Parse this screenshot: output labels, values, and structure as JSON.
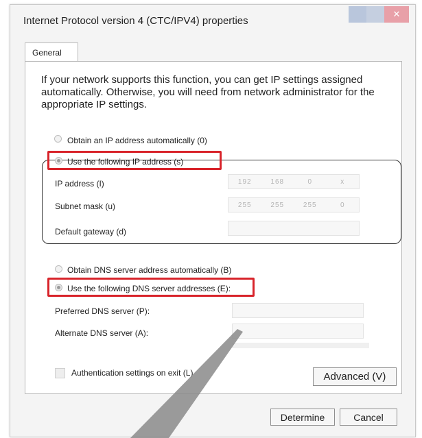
{
  "window": {
    "title": "Internet Protocol version 4 (CTC/IPV4) properties",
    "close_glyph": "✕"
  },
  "tabs": [
    {
      "label": "General"
    }
  ],
  "intro_text": "If your network supports this function, you can get IP settings assigned automatically. Otherwise, you will need from network administrator for the appropriate IP settings.",
  "ip_section": {
    "auto_label": "Obtain an IP address automatically (0)",
    "manual_label": "Use the following IP address (s)",
    "selected": "manual",
    "fields": [
      {
        "label": "IP address (I)",
        "value": [
          "192",
          "168",
          "0",
          "x"
        ]
      },
      {
        "label": "Subnet mask (u)",
        "value": [
          "255",
          "255",
          "255",
          "0"
        ]
      },
      {
        "label": "Default gateway (d)",
        "value": [
          "",
          "",
          "",
          ""
        ]
      }
    ]
  },
  "dns_section": {
    "auto_label": "Obtain DNS server address automatically (B)",
    "manual_label": "Use the following DNS server addresses (E):",
    "selected": "manual",
    "fields": [
      {
        "label": "Preferred DNS server (P):"
      },
      {
        "label": "Alternate DNS server (A):"
      }
    ]
  },
  "auth_label": "Authentication settings on exit (L)",
  "buttons": {
    "advanced": "Advanced (V)",
    "ok": "Determine",
    "cancel": "Cancel"
  },
  "colors": {
    "highlight": "#d8232a",
    "callout": "#8a8a8a"
  }
}
